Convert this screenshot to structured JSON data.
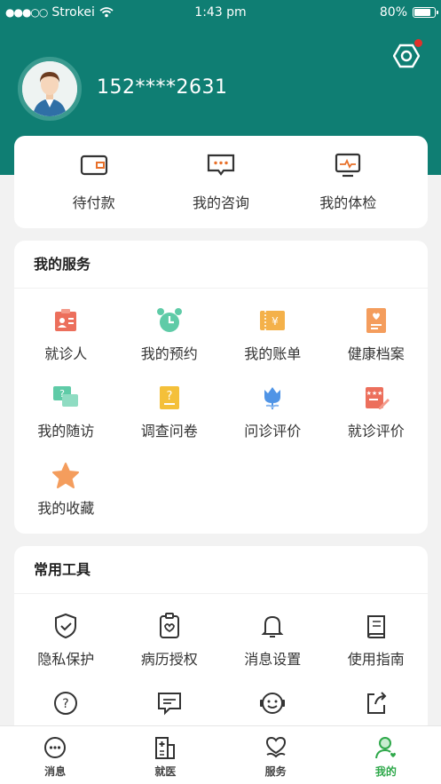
{
  "status_bar": {
    "carrier": "Strokei",
    "time": "1:43 pm",
    "battery": "80%",
    "battery_level": 0.8
  },
  "profile": {
    "phone": "152****2631"
  },
  "quick_actions": [
    {
      "label": "待付款",
      "icon": "wallet-icon"
    },
    {
      "label": "我的咨询",
      "icon": "chat-bubble-icon"
    },
    {
      "label": "我的体检",
      "icon": "monitor-pulse-icon"
    }
  ],
  "services": {
    "title": "我的服务",
    "items": [
      {
        "label": "就诊人",
        "icon": "patient-card-icon",
        "color": "#ec6f5c"
      },
      {
        "label": "我的预约",
        "icon": "alarm-clock-icon",
        "color": "#5fcba7"
      },
      {
        "label": "我的账单",
        "icon": "bill-icon",
        "color": "#f4b14a"
      },
      {
        "label": "健康档案",
        "icon": "health-record-icon",
        "color": "#f49d5d"
      },
      {
        "label": "我的随访",
        "icon": "followup-chat-icon",
        "color": "#5fcba7"
      },
      {
        "label": "调查问卷",
        "icon": "questionnaire-icon",
        "color": "#f4c03a"
      },
      {
        "label": "问诊评价",
        "icon": "tulip-icon",
        "color": "#4f94e6"
      },
      {
        "label": "就诊评价",
        "icon": "review-edit-icon",
        "color": "#ec6f5c"
      },
      {
        "label": "我的收藏",
        "icon": "star-icon",
        "color": "#f49d5d"
      }
    ]
  },
  "tools": {
    "title": "常用工具",
    "items": [
      {
        "label": "隐私保护",
        "icon": "shield-check-icon"
      },
      {
        "label": "病历授权",
        "icon": "clipboard-heart-icon"
      },
      {
        "label": "消息设置",
        "icon": "bell-icon"
      },
      {
        "label": "使用指南",
        "icon": "book-icon"
      },
      {
        "label": "",
        "icon": "help-circle-icon"
      },
      {
        "label": "",
        "icon": "feedback-message-icon"
      },
      {
        "label": "",
        "icon": "customer-service-icon"
      },
      {
        "label": "",
        "icon": "share-icon"
      }
    ]
  },
  "tabbar": [
    {
      "label": "消息",
      "icon": "message-tab-icon"
    },
    {
      "label": "就医",
      "icon": "hospital-tab-icon"
    },
    {
      "label": "服务",
      "icon": "heart-hand-tab-icon"
    },
    {
      "label": "我的",
      "icon": "user-tab-icon",
      "active": true
    }
  ],
  "colors": {
    "header": "#0f7e73",
    "tab_active": "#2ea84a",
    "notification_dot": "#e0322b"
  }
}
